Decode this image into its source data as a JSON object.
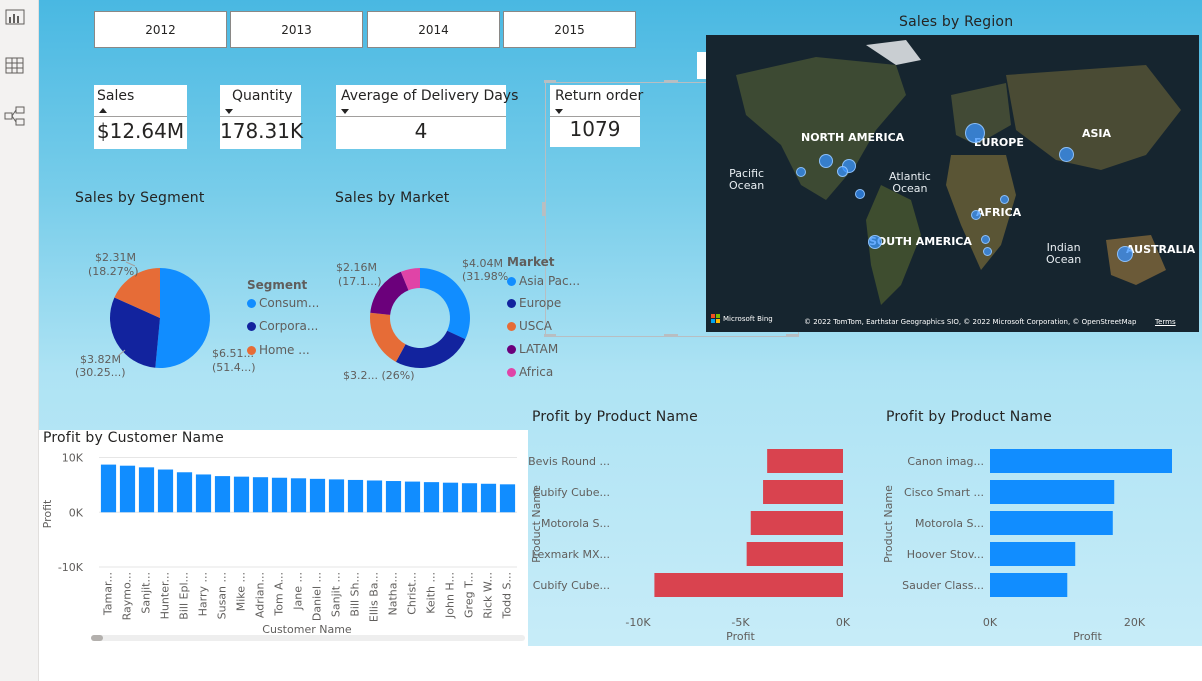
{
  "rail": {
    "icons": [
      "report-view-icon",
      "table-view-icon",
      "model-view-icon"
    ]
  },
  "years": [
    "2012",
    "2013",
    "2014",
    "2015"
  ],
  "cards": {
    "sales": {
      "title": "Sales",
      "value": "$12.64M"
    },
    "quantity": {
      "title": "Quantity",
      "value": "178.31K"
    },
    "delivery": {
      "title": "Average of Delivery Days",
      "value": "4"
    },
    "returns": {
      "title": "Return order",
      "value": "1079"
    }
  },
  "segment_title": "Sales by Segment",
  "market_title": "Sales by Market",
  "region_title": "Sales by Region",
  "segment_labels": {
    "home_value": "$2.31M",
    "home_pct": "(18.27%)",
    "corp_value": "$3.82M",
    "corp_pct": "(30.25...)",
    "cons_value": "$6.51...",
    "cons_pct": "(51.4...)"
  },
  "market_labels": {
    "latam_value": "$2.16M",
    "latam_pct": "(17.1...)",
    "asia_value": "$4.04M",
    "asia_pct": "(31.98%)",
    "europe_label": "$3.2... (26%)"
  },
  "segment_legend": {
    "title": "Segment",
    "items": [
      "Consum...",
      "Corpora...",
      "Home ..."
    ]
  },
  "market_legend": {
    "title": "Market",
    "items": [
      "Asia Pac...",
      "Europe",
      "USCA",
      "LATAM",
      "Africa"
    ]
  },
  "map": {
    "continents": {
      "na": "NORTH AMERICA",
      "eu": "EUROPE",
      "as": "ASIA",
      "af": "AFRICA",
      "sa": "SOUTH AMERICA",
      "au": "AUSTRALIA"
    },
    "oceans": {
      "pacific": "Pacific\nOcean",
      "atlantic": "Atlantic\nOcean",
      "indian": "Indian\nOcean"
    },
    "brand": "Microsoft Bing",
    "copyright": "© 2022 TomTom, Earthstar Geographics SIO, © 2022 Microsoft Corporation, © OpenStreetMap",
    "terms": "Terms"
  },
  "colors": {
    "consumer": "#118dff",
    "corporate": "#12239e",
    "home": "#e66c37",
    "asia": "#118dff",
    "europe": "#12239e",
    "usca": "#e66c37",
    "latam": "#6b007b",
    "africa": "#e044a7",
    "bar_blue": "#118dff",
    "bar_red": "#d9434f"
  },
  "chart_data": [
    {
      "type": "pie",
      "title": "Sales by Segment",
      "legend_title": "Segment",
      "labels": [
        "Consum...",
        "Corpora...",
        "Home ..."
      ],
      "values": [
        6.51,
        3.82,
        2.31
      ],
      "percents": [
        51.4,
        30.25,
        18.27
      ],
      "unit": "$M"
    },
    {
      "type": "pie",
      "subtype": "donut",
      "title": "Sales by Market",
      "legend_title": "Market",
      "labels": [
        "Asia Pac...",
        "Europe",
        "USCA",
        "LATAM",
        "Africa"
      ],
      "values": [
        4.04,
        3.29,
        2.36,
        2.16,
        0.79
      ],
      "percents": [
        31.98,
        26,
        18.66,
        17.1,
        6.26
      ],
      "unit": "$M"
    },
    {
      "type": "bar",
      "title": "Profit by Customer Name",
      "xlabel": "Customer Name",
      "ylabel": "Profit",
      "yticks": [
        "10K",
        "0K",
        "-10K"
      ],
      "ylim": [
        -12000,
        11000
      ],
      "categories": [
        "Tamar...",
        "Raymo...",
        "Sanjit...",
        "Hunter...",
        "Bill Epl...",
        "Harry ...",
        "Susan ...",
        "Mike ...",
        "Adrian...",
        "Tom A...",
        "Jane ...",
        "Daniel ...",
        "Sanjit ...",
        "Bill Sh...",
        "Ellis Ba...",
        "Natha...",
        "Christ...",
        "Keith ...",
        "John H...",
        "Greg T...",
        "Rick W...",
        "Todd S..."
      ],
      "values": [
        8700,
        8500,
        8200,
        7800,
        7300,
        6900,
        6600,
        6500,
        6400,
        6300,
        6200,
        6100,
        6000,
        5900,
        5800,
        5700,
        5600,
        5500,
        5400,
        5300,
        5200,
        5100
      ]
    },
    {
      "type": "bar",
      "orientation": "horizontal",
      "title": "Profit by Product Name",
      "xlabel": "Profit",
      "ylabel": "Product Name",
      "xticks": [
        "-10K",
        "-5K",
        "0K"
      ],
      "xlim": [
        -10000,
        0
      ],
      "categories": [
        "Bevis Round ...",
        "Cubify Cube...",
        "Motorola S...",
        "Lexmark MX...",
        "Cubify Cube..."
      ],
      "values": [
        -3700,
        -3900,
        -4500,
        -4700,
        -9200
      ]
    },
    {
      "type": "bar",
      "orientation": "horizontal",
      "title": "Profit by Product Name",
      "xlabel": "Profit",
      "ylabel": "Product Name",
      "xticks": [
        "0K",
        "20K"
      ],
      "xlim": [
        0,
        27000
      ],
      "categories": [
        "Canon imag...",
        "Cisco Smart ...",
        "Motorola S...",
        "Hoover Stov...",
        "Sauder Class..."
      ],
      "values": [
        25200,
        17200,
        17000,
        11800,
        10700
      ]
    }
  ]
}
